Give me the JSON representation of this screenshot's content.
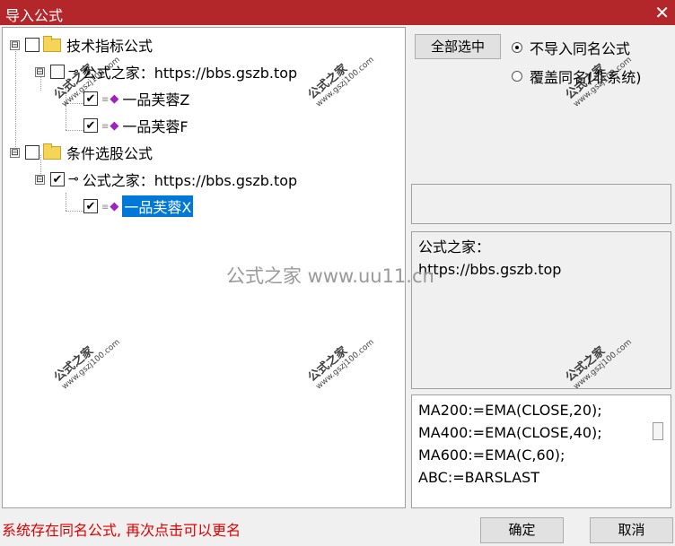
{
  "window": {
    "title": "导入公式",
    "close_glyph": "✕"
  },
  "tree": {
    "groups": [
      {
        "label": "技术指标公式",
        "expander": "⊟",
        "source": "公式之家：https://bbs.gszb.top",
        "items": [
          {
            "label": "一品芙蓉Z"
          },
          {
            "label": "一品芙蓉F"
          }
        ]
      },
      {
        "label": "条件选股公式",
        "expander": "⊟",
        "source": "公式之家：https://bbs.gszb.top",
        "items": [
          {
            "label": "一品芙蓉X",
            "selected": true
          }
        ]
      }
    ]
  },
  "options": {
    "select_all_label": "全部选中",
    "radio_skip_label": "不导入同名公式",
    "radio_overwrite_label": "覆盖同名(非系统)",
    "selected_radio": "skip"
  },
  "info": {
    "line1": "公式之家：",
    "line2": "https://bbs.gszb.top"
  },
  "code": {
    "lines": [
      "MA200:=EMA(CLOSE,20);",
      "MA400:=EMA(CLOSE,40);",
      "MA600:=EMA(C,60);",
      "ABC:=BARSLAST"
    ]
  },
  "status": {
    "message": "系统存在同名公式, 再次点击可以更名"
  },
  "footer": {
    "ok_label": "确定",
    "cancel_label": "取消"
  },
  "watermark": {
    "text": "公式之家",
    "url": "www.gszj100.com",
    "center": "公式之家 www.uu11.cn"
  },
  "colors": {
    "titlebar": "#b3262a",
    "selection": "#0078d7",
    "status_text": "#e00000",
    "gem": "#a020c0"
  },
  "icons": {
    "folder": "folder-icon",
    "key": "key-icon",
    "formula": "formula-gem-icon"
  }
}
